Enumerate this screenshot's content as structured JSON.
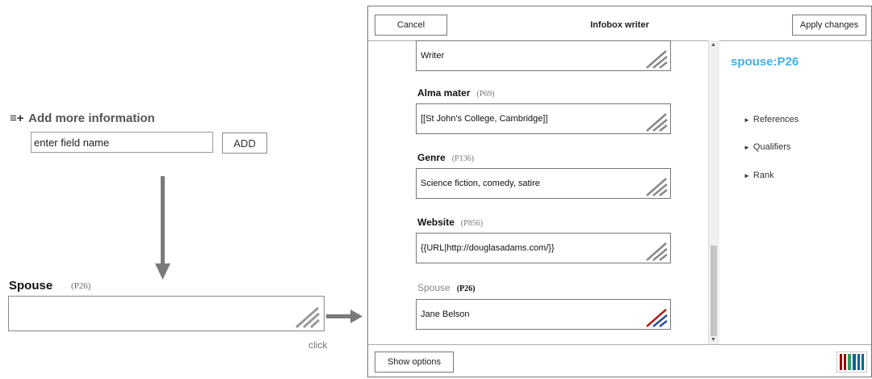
{
  "left": {
    "add_info_icon": "≡+",
    "add_info_label": "Add more information",
    "field_name_placeholder": "enter field name",
    "add_button": "ADD",
    "spouse_label": "Spouse",
    "spouse_pid": "(P26)",
    "spouse_value": "",
    "click_label": "click"
  },
  "dialog": {
    "cancel": "Cancel",
    "title": "Infobox writer",
    "apply": "Apply changes",
    "show_options": "Show options",
    "fields": [
      {
        "label": "",
        "pid": "",
        "value": "Writer"
      },
      {
        "label": "Alma mater",
        "pid": "(P69)",
        "value": "[[St John's College, Cambridge]]"
      },
      {
        "label": "Genre",
        "pid": "(P136)",
        "value": "Science fiction, comedy, satire"
      },
      {
        "label": "Website",
        "pid": "(P856)",
        "value": "{{URL|http://douglasadams.com/}}"
      },
      {
        "label": "Spouse",
        "pid": "(P26)",
        "value": "Jane Belson"
      }
    ],
    "side": {
      "title": "spouse:P26",
      "items": [
        "References",
        "Qualifiers",
        "Rank"
      ]
    }
  },
  "colors": {
    "accent": "#3fb0e8",
    "wikidata_red": "#990000",
    "wikidata_green": "#339966",
    "wikidata_blue": "#006699"
  }
}
